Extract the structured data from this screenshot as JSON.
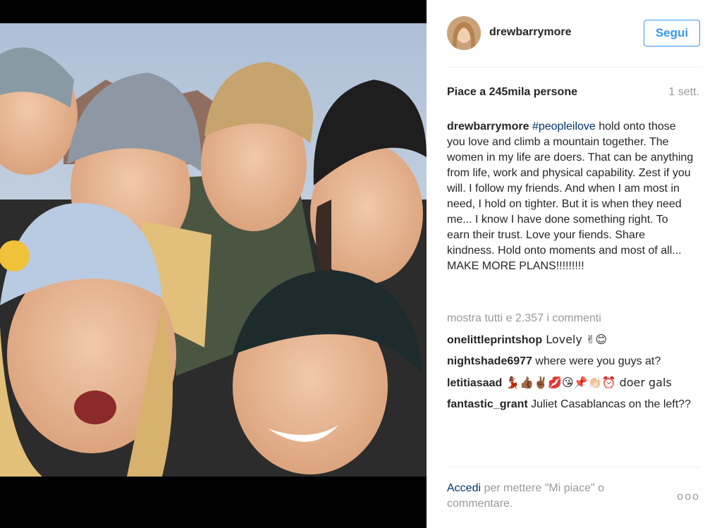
{
  "post": {
    "username": "drewbarrymore",
    "follow_label": "Segui",
    "likes_text": "Piace a 245mila persone",
    "time_ago": "1 sett.",
    "caption": {
      "author": "drewbarrymore",
      "hashtag": "#peopleilove",
      "text": " hold onto those you love and climb a mountain together. The women in my life are doers. That can be anything from life, work and physical capability. Zest if you will. I follow my friends. And when I am most in need, I hold on tighter. But it is when they need me... I know I have done something right. To earn their trust. Love your fiends. Share kindness. Hold onto moments and most of all... MAKE MORE PLANS!!!!!!!!!"
    },
    "show_all_comments": "mostra tutti e 2.357 i commenti",
    "comments": [
      {
        "user": "onelittleprintshop",
        "text": " Lovely ✌😊"
      },
      {
        "user": "nightshade6977",
        "text": " where were you guys at?"
      },
      {
        "user": "letitiasaad",
        "text": " 💃🏾👍🏾✌🏾💋😘📌👏🏻⏰ doer gals"
      },
      {
        "user": "fantastic_grant",
        "text": " Juliet Casablancas on the left??"
      }
    ],
    "footer": {
      "login_label": "Accedi",
      "login_rest": " per mettere \"Mi piace\" o commentare.",
      "more_label": "ooo"
    }
  }
}
